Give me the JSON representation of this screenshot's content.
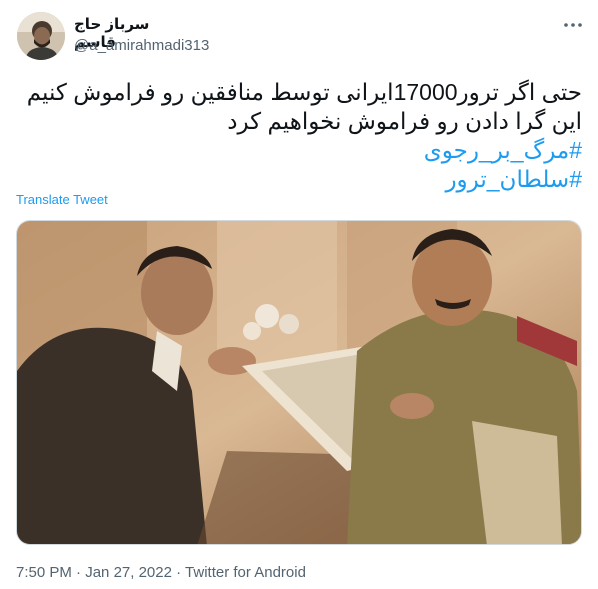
{
  "user": {
    "display_name": "سرباز حاج قاسم",
    "handle": "@a_amirahmadi313"
  },
  "tweet": {
    "line1": "حتی اگر ترور17000ایرانی توسط منافقین رو فراموش کنیم",
    "line2": "این گرا دادن رو فراموش نخواهیم کرد",
    "hashtag1": "#مرگ_بر_رجوی",
    "hashtag2": "#سلطان_ترور"
  },
  "translate_label": "Translate Tweet",
  "meta": {
    "time": "7:50 PM",
    "separator": " · ",
    "date": "Jan 27, 2022",
    "source": "Twitter for Android"
  },
  "icons": {
    "more": "more-horizontal-icon"
  },
  "colors": {
    "link": "#1d9bf0",
    "secondary_text": "#536471"
  }
}
